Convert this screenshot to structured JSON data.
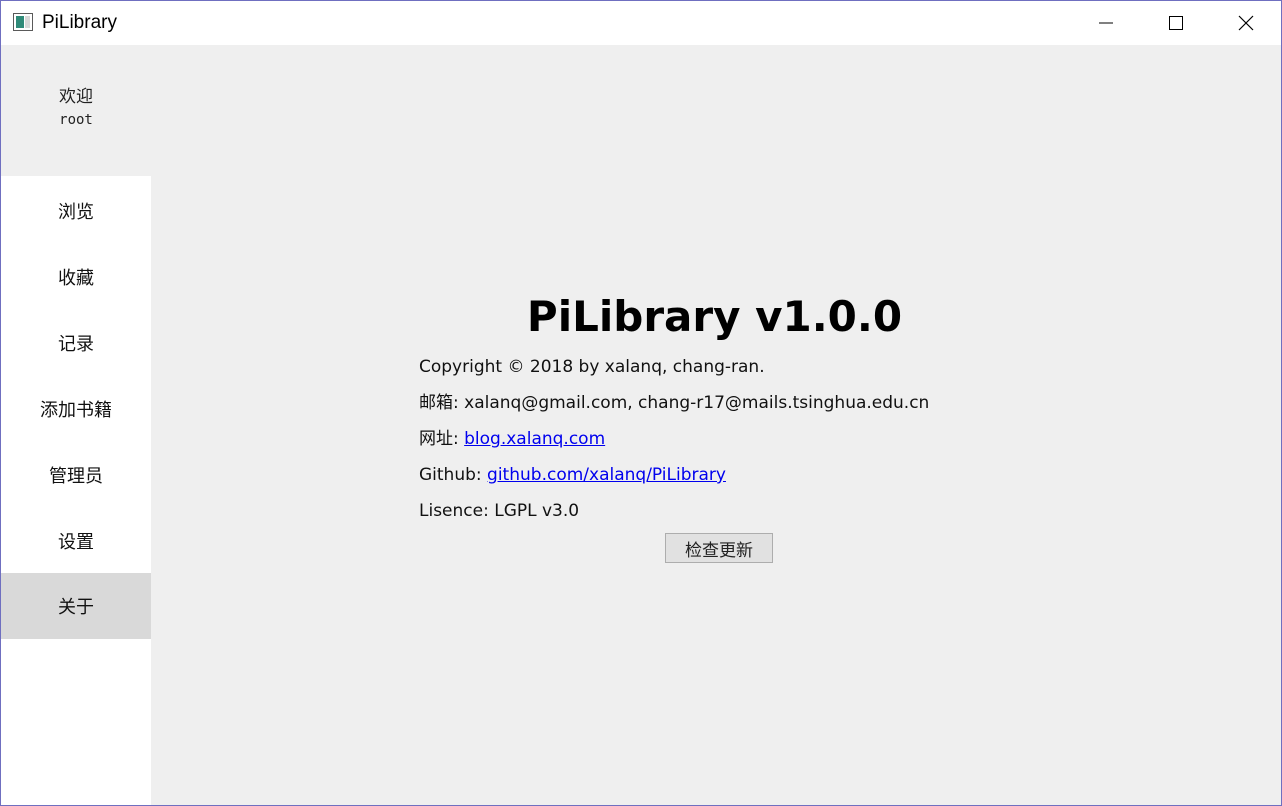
{
  "window": {
    "title": "PiLibrary"
  },
  "sidebar": {
    "welcome_label": "欢迎",
    "username": "root",
    "items": [
      {
        "label": "浏览",
        "active": false
      },
      {
        "label": "收藏",
        "active": false
      },
      {
        "label": "记录",
        "active": false
      },
      {
        "label": "添加书籍",
        "active": false
      },
      {
        "label": "管理员",
        "active": false
      },
      {
        "label": "设置",
        "active": false
      },
      {
        "label": "关于",
        "active": true
      }
    ]
  },
  "about": {
    "title": "PiLibrary v1.0.0",
    "copyright": "Copyright © 2018 by xalanq, chang-ran.",
    "email_label": "邮箱: ",
    "email_value": "xalanq@gmail.com, chang-r17@mails.tsinghua.edu.cn",
    "website_label": "网址: ",
    "website_link": "blog.xalanq.com",
    "github_label": "Github: ",
    "github_link": "github.com/xalanq/PiLibrary",
    "license": "Lisence: LGPL v3.0",
    "check_update_label": "检查更新"
  },
  "icons": {
    "minimize": "minimize-icon",
    "maximize": "maximize-icon",
    "close": "close-icon",
    "app": "app-window-icon"
  },
  "colors": {
    "link": "#0000ee",
    "active_nav": "#d9d9d9",
    "content_bg": "#efefef",
    "window_border": "#6f6fc0"
  }
}
